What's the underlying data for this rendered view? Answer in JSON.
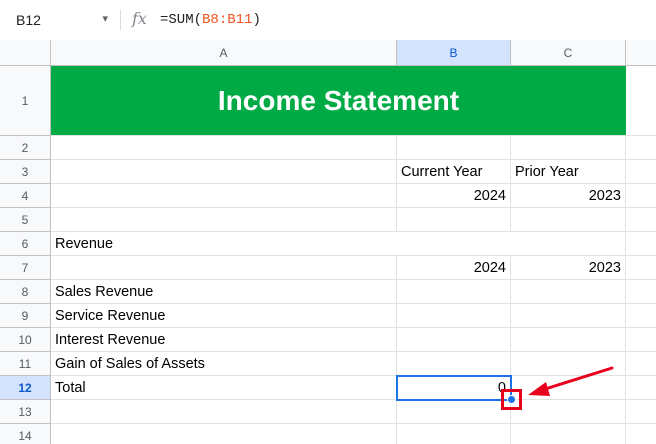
{
  "formula_bar": {
    "name_box": "B12",
    "caret": "▾",
    "fx": "fx",
    "formula_prefix": "=SUM(",
    "formula_ref": "B8:B11",
    "formula_suffix": ")"
  },
  "columns": [
    "A",
    "B",
    "C"
  ],
  "selected_column": "B",
  "rows": [
    "1",
    "2",
    "3",
    "4",
    "5",
    "6",
    "7",
    "8",
    "9",
    "10",
    "11",
    "12",
    "13",
    "14"
  ],
  "selected_row": "12",
  "sheet": {
    "title": "Income Statement",
    "b3": "Current Year",
    "c3": "Prior Year",
    "b4": "2024",
    "c4": "2023",
    "a6": "Revenue",
    "b7": "2024",
    "c7": "2023",
    "a8": "Sales Revenue",
    "a9": "Service Revenue",
    "a10": "Interest Revenue",
    "a11": "Gain of Sales of Assets",
    "a12": "Total",
    "b12": "0"
  },
  "colors": {
    "title_band": "#00aa44",
    "selection": "#1a73e8",
    "annotation": "#e8001c"
  }
}
